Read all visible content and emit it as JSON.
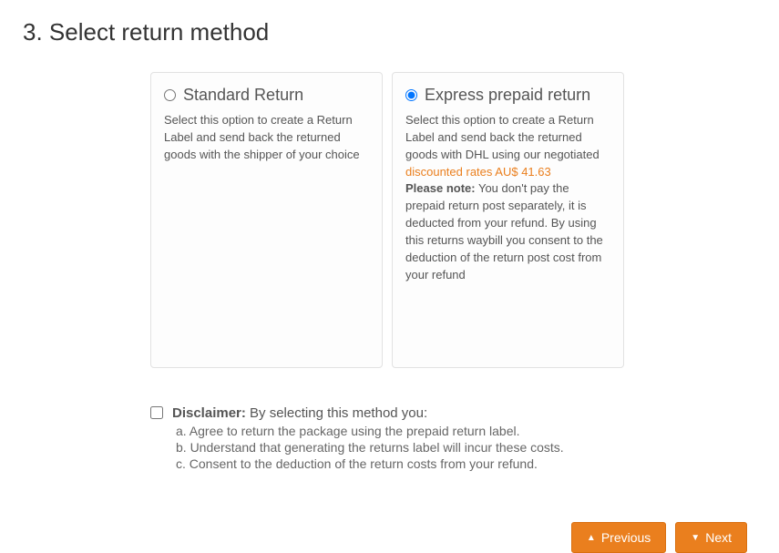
{
  "title": "3. Select return method",
  "options": {
    "standard": {
      "title": "Standard Return",
      "desc": "Select this option to create a Return Label and send back the returned goods with the shipper of your choice"
    },
    "express": {
      "title": "Express prepaid return",
      "desc_pre": "Select this option to create a Return Label and send back the returned goods with DHL using our negotiated ",
      "rate_link_text": "discounted rates AU$ 41.63",
      "note_label": "Please note:",
      "note_text": " You don't pay the prepaid return post separately, it is deducted from your refund. By using this returns waybill you consent to the deduction of the return post cost from your refund"
    }
  },
  "disclaimer": {
    "label": "Disclaimer:",
    "intro": " By selecting this method you:",
    "a": "a. Agree to return the package using the prepaid return label.",
    "b": "b. Understand that generating the returns label will incur these costs.",
    "c": "c. Consent to the deduction of the return costs from your refund."
  },
  "buttons": {
    "previous": "Previous",
    "next": "Next"
  }
}
